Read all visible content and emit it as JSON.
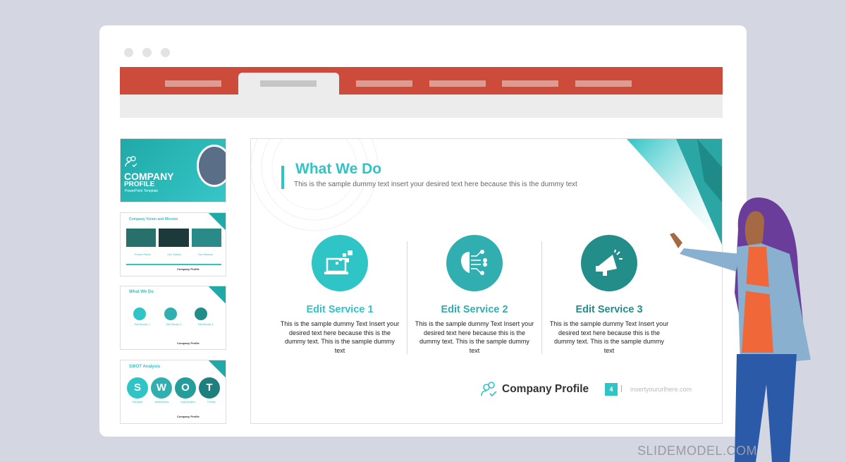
{
  "colors": {
    "ribbon": "#cd4b3a",
    "teal": "#2fc4c6",
    "teal_mid": "#31aeb0",
    "teal_dark": "#238d8a",
    "background": "#d4d6e2"
  },
  "thumbnails": [
    {
      "title": "COMPANY",
      "subtitle": "PROFILE",
      "tagline": "PowerPoint Template"
    },
    {
      "title": "Company Vision and Mission",
      "items": [
        "Future Plans",
        "Our Values",
        "Our Mission"
      ],
      "footer": "Company Profile"
    },
    {
      "title": "What We Do",
      "items": [
        "Edit Service 1",
        "Edit Service 2",
        "Edit Service 3"
      ],
      "footer": "Company Profile"
    },
    {
      "title": "SWOT Analysis",
      "letters": [
        "S",
        "W",
        "O",
        "T"
      ],
      "items": [
        "Strengths",
        "Weaknesses",
        "Opportunities",
        "Threats"
      ],
      "footer": "Company Profile"
    }
  ],
  "slide": {
    "title": "What We Do",
    "subtitle": "This is the sample dummy text insert your desired text here because this is the dummy text",
    "services": [
      {
        "title": "Edit Service 1",
        "icon": "laptop-pixels-icon",
        "text": "This is the sample dummy Text Insert your desired text here because this is the dummy text. This is the sample dummy text"
      },
      {
        "title": "Edit Service 2",
        "icon": "brain-circuit-icon",
        "text": "This is the sample dummy Text Insert your desired text here because this is the dummy text. This is the sample dummy text"
      },
      {
        "title": "Edit Service 3",
        "icon": "megaphone-icon",
        "text": "This is the sample dummy Text Insert your desired text here because this is the dummy text. This is the sample dummy text"
      }
    ],
    "footer": {
      "brand": "Company Profile",
      "page": "4",
      "url": "insertyoururlhere.com"
    }
  },
  "watermark": "SLIDEMODEL.COM"
}
